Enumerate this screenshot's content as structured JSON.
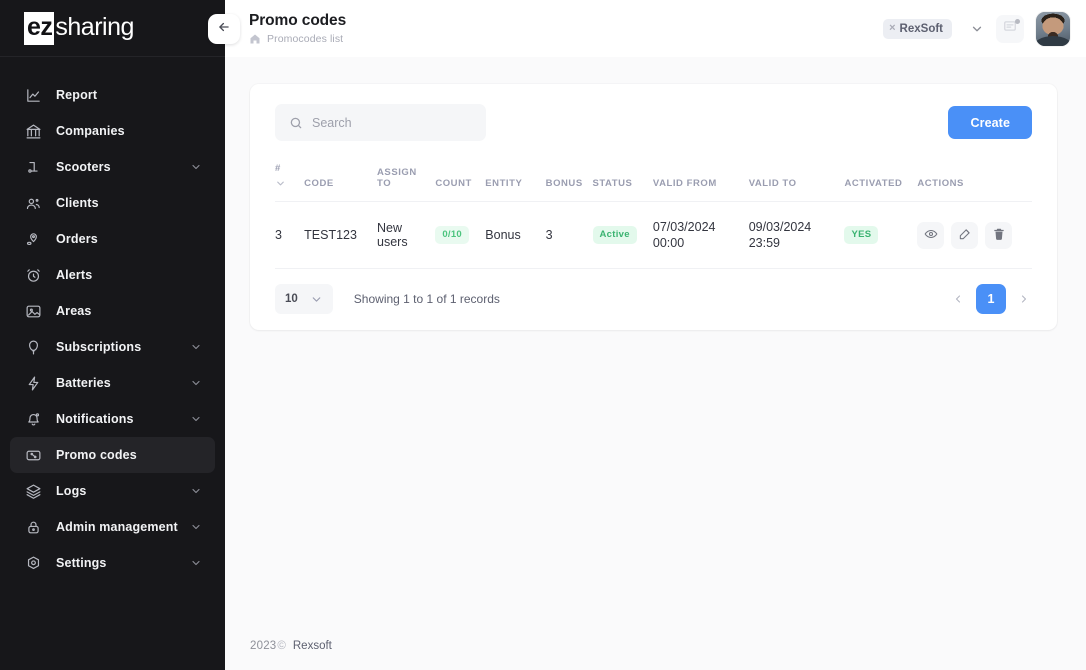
{
  "brand": {
    "part1": "ez",
    "part2": "sharing"
  },
  "sidebar": {
    "collapse_label": "←",
    "items": [
      {
        "label": "Report",
        "icon": "chart-line-icon",
        "expandable": false,
        "active": false
      },
      {
        "label": "Companies",
        "icon": "bank-icon",
        "expandable": false,
        "active": false
      },
      {
        "label": "Scooters",
        "icon": "scooter-icon",
        "expandable": true,
        "active": false
      },
      {
        "label": "Clients",
        "icon": "users-icon",
        "expandable": false,
        "active": false
      },
      {
        "label": "Orders",
        "icon": "map-pin-icon",
        "expandable": false,
        "active": false
      },
      {
        "label": "Alerts",
        "icon": "alarm-clock-icon",
        "expandable": false,
        "active": false
      },
      {
        "label": "Areas",
        "icon": "image-area-icon",
        "expandable": false,
        "active": false
      },
      {
        "label": "Subscriptions",
        "icon": "balloon-icon",
        "expandable": true,
        "active": false
      },
      {
        "label": "Batteries",
        "icon": "bolt-icon",
        "expandable": true,
        "active": false
      },
      {
        "label": "Notifications",
        "icon": "bell-icon",
        "expandable": true,
        "active": false
      },
      {
        "label": "Promo codes",
        "icon": "ticket-percent-icon",
        "expandable": false,
        "active": true
      },
      {
        "label": "Logs",
        "icon": "layers-icon",
        "expandable": true,
        "active": false
      },
      {
        "label": "Admin management",
        "icon": "lock-icon",
        "expandable": true,
        "active": false
      },
      {
        "label": "Settings",
        "icon": "gear-icon",
        "expandable": true,
        "active": false
      }
    ]
  },
  "header": {
    "title": "Promo codes",
    "breadcrumb": "Promocodes list",
    "company_chip": "RexSoft",
    "company_chip_remove": "×"
  },
  "toolbar": {
    "search_value": "",
    "search_placeholder": "Search",
    "create_label": "Create"
  },
  "table": {
    "columns": [
      "#",
      "CODE",
      "ASSIGN TO",
      "COUNT",
      "ENTITY",
      "BONUS",
      "STATUS",
      "VALID FROM",
      "VALID TO",
      "ACTIVATED",
      "ACTIONS"
    ],
    "column_assign_line1": "ASSIGN",
    "column_assign_line2": "TO",
    "rows": [
      {
        "num": "3",
        "code": "TEST123",
        "assign_to": "New users",
        "count": "0/10",
        "entity": "Bonus",
        "bonus": "3",
        "status": "Active",
        "valid_from_date": "07/03/2024",
        "valid_from_time": "00:00",
        "valid_to_date": "09/03/2024",
        "valid_to_time": "23:59",
        "activated": "YES"
      }
    ]
  },
  "footer_bar": {
    "per_page": "10",
    "records_text": "Showing 1 to 1 of 1 records",
    "prev": "‹",
    "page": "1",
    "next": "›"
  },
  "page_footer": {
    "year": "2023",
    "copyright": "©",
    "company": "Rexsoft"
  },
  "colors": {
    "accent": "#4a90f7",
    "sidebar_bg": "#17171a",
    "page_bg": "#fafafb",
    "success": "#3bb371",
    "success_bg": "#e3f9ec"
  }
}
